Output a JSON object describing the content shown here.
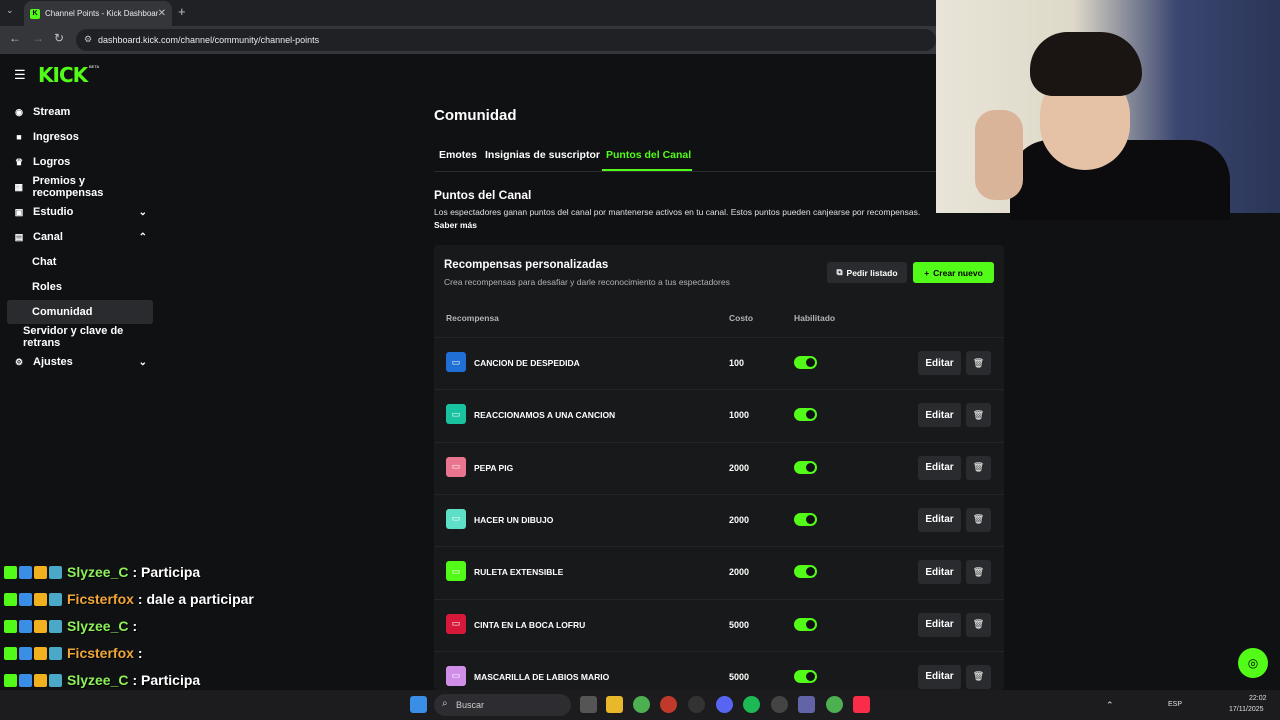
{
  "browser": {
    "tab_title": "Channel Points - Kick Dashboar",
    "url": "dashboard.kick.com/channel/community/channel-points"
  },
  "sidebar": {
    "logo": "KICK",
    "logo_badge": "BETA",
    "items": [
      {
        "label": "Stream",
        "icon": "broadcast-icon"
      },
      {
        "label": "Ingresos",
        "icon": "wallet-icon"
      },
      {
        "label": "Logros",
        "icon": "trophy-icon"
      },
      {
        "label": "Premios y recompensas",
        "icon": "gift-icon"
      },
      {
        "label": "Estudio",
        "icon": "studio-icon"
      },
      {
        "label": "Canal",
        "icon": "channel-icon"
      },
      {
        "label": "Chat"
      },
      {
        "label": "Roles"
      },
      {
        "label": "Comunidad"
      },
      {
        "label": "Servidor y clave de retrans"
      },
      {
        "label": "Ajustes",
        "icon": "gear-icon"
      }
    ]
  },
  "main": {
    "title": "Comunidad",
    "tabs": [
      "Emotes",
      "Insignias de suscriptor",
      "Puntos del Canal"
    ],
    "active_tab": "Puntos del Canal",
    "section_title": "Puntos del Canal",
    "section_desc": "Los espectadores ganan puntos del canal por mantenerse activos en tu canal. Estos puntos pueden canjearse por recompensas.",
    "section_link": "Saber más",
    "accent": "#53fc18"
  },
  "rewards": {
    "title": "Recompensas personalizadas",
    "subtitle": "Crea recompensas para desafiar y darle reconocimiento a tus espectadores",
    "list_button": "Pedir listado",
    "new_button": "Crear nuevo",
    "columns": [
      "Recompensa",
      "Costo",
      "Habilitado"
    ],
    "edit_label": "Editar",
    "rows": [
      {
        "name": "CANCION DE DESPEDIDA",
        "cost": "100",
        "enabled": true,
        "color": "#1f6fd6"
      },
      {
        "name": "REACCIONAMOS A UNA CANCION",
        "cost": "1000",
        "enabled": true,
        "color": "#19c2a0"
      },
      {
        "name": "PEPA PIG",
        "cost": "2000",
        "enabled": true,
        "color": "#e8748f"
      },
      {
        "name": "HACER UN DIBUJO",
        "cost": "2000",
        "enabled": true,
        "color": "#5ee0c8"
      },
      {
        "name": "RULETA EXTENSIBLE",
        "cost": "2000",
        "enabled": true,
        "color": "#53fc18"
      },
      {
        "name": "CINTA EN LA BOCA LOFRU",
        "cost": "5000",
        "enabled": true,
        "color": "#d6193a"
      },
      {
        "name": "MASCARILLA DE LABIOS MARIO",
        "cost": "5000",
        "enabled": true,
        "color": "#d08ee8"
      }
    ]
  },
  "chat_overlay": [
    {
      "user": "Slyzee_C",
      "message": ": Participa",
      "color": "#8ef05a"
    },
    {
      "user": "Ficsterfox",
      "message": ": dale a participar",
      "color": "#f0a63a"
    },
    {
      "user": "Slyzee_C",
      "message": ":",
      "color": "#8ef05a"
    },
    {
      "user": "Ficsterfox",
      "message": ":",
      "color": "#f0a63a"
    },
    {
      "user": "Slyzee_C",
      "message": ": Participa",
      "color": "#8ef05a"
    },
    {
      "user": "Slyzee_C",
      "message": ":",
      "color": "#8ef05a"
    }
  ],
  "taskbar": {
    "search": "Buscar",
    "lang": "ESP",
    "time": "22:02",
    "date": "17/11/2025"
  }
}
